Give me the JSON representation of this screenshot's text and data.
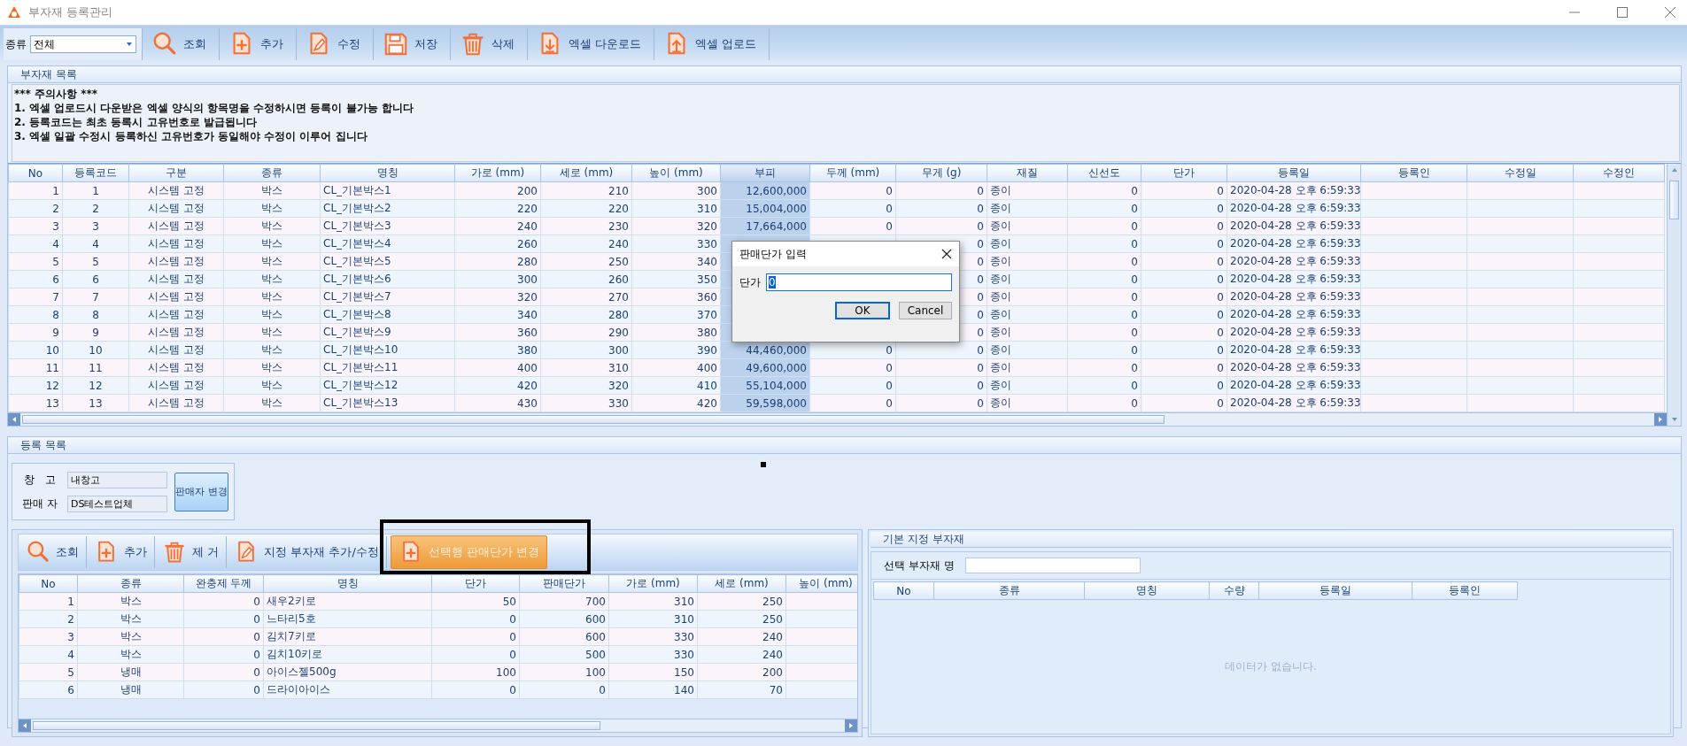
{
  "window": {
    "title": "부자재 등록관리"
  },
  "toolbar": {
    "filter": {
      "label": "종류",
      "value": "전체"
    },
    "buttons": [
      {
        "label": "조회",
        "kind": "search"
      },
      {
        "label": "추가",
        "kind": "add"
      },
      {
        "label": "수정",
        "kind": "edit"
      },
      {
        "label": "저장",
        "kind": "save"
      },
      {
        "label": "삭제",
        "kind": "delete"
      },
      {
        "label": "엑셀 다운로드",
        "kind": "download"
      },
      {
        "label": "엑셀 업로드",
        "kind": "upload"
      }
    ]
  },
  "material_list": {
    "title": "부자재 목록",
    "notice": [
      "*** 주의사항 ***",
      "1. 엑셀 업로드시 다운받은 엑셀 양식의 항목명을 수정하시면 등록이 불가능 합니다",
      "2. 등록코드는 최초 등록시 고유번호로 발급됩니다",
      "3. 엑셀 일괄 수정시 등록하신 고유번호가 동일해야 수정이 이루어 집니다"
    ],
    "grid": {
      "columns": [
        {
          "label": "No",
          "selected": false
        },
        {
          "label": "등록코드",
          "selected": false
        },
        {
          "label": "구분",
          "selected": false
        },
        {
          "label": "종류",
          "selected": false
        },
        {
          "label": "명칭",
          "selected": false
        },
        {
          "label": "가로 (mm)",
          "selected": false
        },
        {
          "label": "세로 (mm)",
          "selected": false
        },
        {
          "label": "높이 (mm)",
          "selected": false
        },
        {
          "label": "부피",
          "selected": true
        },
        {
          "label": "두께 (mm)",
          "selected": false
        },
        {
          "label": "무게 (g)",
          "selected": false
        },
        {
          "label": "재질",
          "selected": false
        },
        {
          "label": "신선도",
          "selected": false
        },
        {
          "label": "단가",
          "selected": false
        },
        {
          "label": "등록일",
          "selected": false
        },
        {
          "label": "등록인",
          "selected": false
        },
        {
          "label": "수정일",
          "selected": false
        },
        {
          "label": "수정인",
          "selected": false
        }
      ],
      "rows": [
        {
          "cells": [
            "1",
            "1",
            "시스템 고정",
            "박스",
            "CL_기본박스1",
            "200",
            "210",
            "300",
            "12,600,000",
            "0",
            "0",
            "종이",
            "0",
            "0",
            "2020-04-28 오후 6:59:33",
            null,
            null,
            null
          ]
        },
        {
          "cells": [
            "2",
            "2",
            "시스템 고정",
            "박스",
            "CL_기본박스2",
            "220",
            "220",
            "310",
            "15,004,000",
            "0",
            "0",
            "종이",
            "0",
            "0",
            "2020-04-28 오후 6:59:33",
            null,
            null,
            null
          ]
        },
        {
          "cells": [
            "3",
            "3",
            "시스템 고정",
            "박스",
            "CL_기본박스3",
            "240",
            "230",
            "320",
            "17,664,000",
            "0",
            "0",
            "종이",
            "0",
            "0",
            "2020-04-28 오후 6:59:33",
            null,
            null,
            null
          ]
        },
        {
          "cells": [
            "4",
            "4",
            "시스템 고정",
            "박스",
            "CL_기본박스4",
            "260",
            "240",
            "330",
            null,
            null,
            "0",
            "종이",
            "0",
            "0",
            "2020-04-28 오후 6:59:33",
            null,
            null,
            null
          ]
        },
        {
          "cells": [
            "5",
            "5",
            "시스템 고정",
            "박스",
            "CL_기본박스5",
            "280",
            "250",
            "340",
            null,
            null,
            "0",
            "종이",
            "0",
            "0",
            "2020-04-28 오후 6:59:33",
            null,
            null,
            null
          ]
        },
        {
          "cells": [
            "6",
            "6",
            "시스템 고정",
            "박스",
            "CL_기본박스6",
            "300",
            "260",
            "350",
            null,
            null,
            "0",
            "종이",
            "0",
            "0",
            "2020-04-28 오후 6:59:33",
            null,
            null,
            null
          ]
        },
        {
          "cells": [
            "7",
            "7",
            "시스템 고정",
            "박스",
            "CL_기본박스7",
            "320",
            "270",
            "360",
            null,
            null,
            "0",
            "종이",
            "0",
            "0",
            "2020-04-28 오후 6:59:33",
            null,
            null,
            null
          ]
        },
        {
          "cells": [
            "8",
            "8",
            "시스템 고정",
            "박스",
            "CL_기본박스8",
            "340",
            "280",
            "370",
            null,
            null,
            "0",
            "종이",
            "0",
            "0",
            "2020-04-28 오후 6:59:33",
            null,
            null,
            null
          ]
        },
        {
          "cells": [
            "9",
            "9",
            "시스템 고정",
            "박스",
            "CL_기본박스9",
            "360",
            "290",
            "380",
            null,
            null,
            "0",
            "종이",
            "0",
            "0",
            "2020-04-28 오후 6:59:33",
            null,
            null,
            null
          ]
        },
        {
          "cells": [
            "10",
            "10",
            "시스템 고정",
            "박스",
            "CL_기본박스10",
            "380",
            "300",
            "390",
            "44,460,000",
            "0",
            "0",
            "종이",
            "0",
            "0",
            "2020-04-28 오후 6:59:33",
            null,
            null,
            null
          ]
        },
        {
          "cells": [
            "11",
            "11",
            "시스템 고정",
            "박스",
            "CL_기본박스11",
            "400",
            "310",
            "400",
            "49,600,000",
            "0",
            "0",
            "종이",
            "0",
            "0",
            "2020-04-28 오후 6:59:33",
            null,
            null,
            null
          ]
        },
        {
          "cells": [
            "12",
            "12",
            "시스템 고정",
            "박스",
            "CL_기본박스12",
            "420",
            "320",
            "410",
            "55,104,000",
            "0",
            "0",
            "종이",
            "0",
            "0",
            "2020-04-28 오후 6:59:33",
            null,
            null,
            null
          ]
        },
        {
          "cells": [
            "13",
            "13",
            "시스템 고정",
            "박스",
            "CL_기본박스13",
            "430",
            "330",
            "420",
            "59,598,000",
            "0",
            "0",
            "종이",
            "0",
            "0",
            "2020-04-28 오후 6:59:33",
            null,
            null,
            null
          ]
        }
      ]
    }
  },
  "registration": {
    "title": "등록 목록",
    "warehouse": {
      "label": "창   고",
      "value": "내창고"
    },
    "seller": {
      "label": "판매 자",
      "value": "DS테스트업체"
    },
    "change_button": "판매자 변경",
    "toolbar": [
      {
        "label": "조회",
        "kind": "search",
        "highlighted": false
      },
      {
        "label": "추가",
        "kind": "add",
        "highlighted": false
      },
      {
        "label": "제 거",
        "kind": "delete",
        "highlighted": false
      },
      {
        "label": "지정 부자재 추가/수정",
        "kind": "edit",
        "highlighted": false
      },
      {
        "label": "선택행 판매단가 변경",
        "kind": "add",
        "highlighted": true
      }
    ],
    "grid": {
      "columns": [
        "No",
        "종류",
        "완충제 두께",
        "명칭",
        "단가",
        "판매단가",
        "가로 (mm)",
        "세로 (mm)",
        "높이 (mm)"
      ],
      "rows": [
        {
          "cells": [
            "1",
            "박스",
            "0",
            "새우2키로",
            "50",
            "700",
            "310",
            "250"
          ]
        },
        {
          "cells": [
            "2",
            "박스",
            "0",
            "느타리5호",
            "0",
            "600",
            "310",
            "250"
          ]
        },
        {
          "cells": [
            "3",
            "박스",
            "0",
            "김치7키로",
            "0",
            "600",
            "330",
            "240"
          ]
        },
        {
          "cells": [
            "4",
            "박스",
            "0",
            "김치10키로",
            "0",
            "500",
            "330",
            "240"
          ]
        },
        {
          "cells": [
            "5",
            "냉매",
            "0",
            "아이스젤500g",
            "100",
            "100",
            "150",
            "200"
          ]
        },
        {
          "cells": [
            "6",
            "냉매",
            "0",
            "드라이아이스",
            "0",
            "0",
            "140",
            "70"
          ]
        }
      ]
    }
  },
  "default_materials": {
    "title": "기본 지정 부자재",
    "search_label": "선택 부자재 명",
    "columns": [
      "No",
      "종류",
      "명칭",
      "수량",
      "등록일",
      "등록인"
    ],
    "empty_text": "데이터가 없습니다."
  },
  "dialog": {
    "title": "판매단가 입력",
    "field_label": "단가",
    "value": "0",
    "buttons": [
      {
        "label": "OK",
        "default": true
      },
      {
        "label": "Cancel",
        "default": false
      }
    ]
  }
}
